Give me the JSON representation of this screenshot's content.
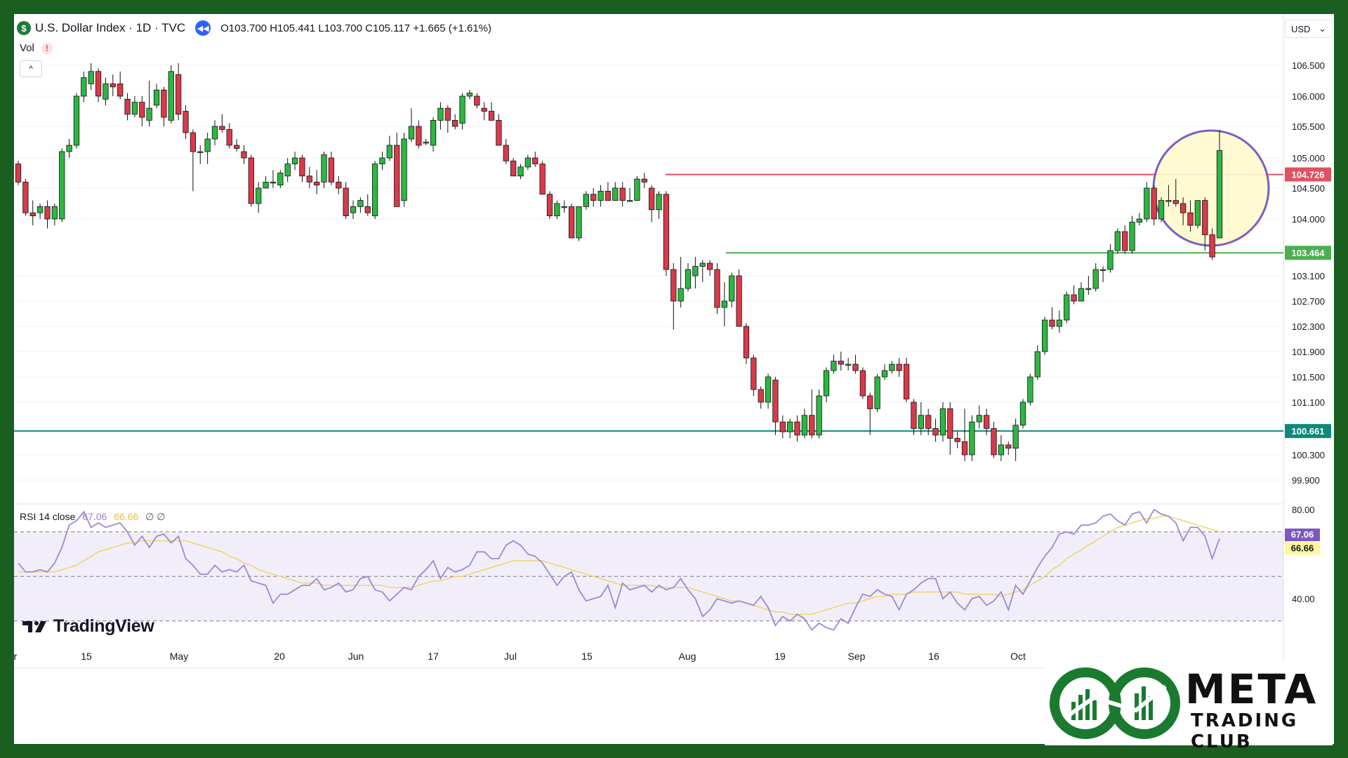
{
  "header": {
    "symbol_badge": "$",
    "title": "U.S. Dollar Index · 1D · TVC",
    "ohlc": "O103.700  H105.441  L103.700  C105.117  +1.665 (+1.61%)"
  },
  "volume_label": "Vol",
  "volume_warning": "!",
  "collapse_glyph": "^",
  "currency": {
    "label": "USD",
    "chevron": "⌄"
  },
  "rsi_legend": {
    "label": "RSI 14 close",
    "rsi": "67.06",
    "ma": "66.66",
    "extra": "∅ ∅"
  },
  "brand": {
    "tradingview": "TradingView",
    "meta": "META",
    "club": "TRADING CLUB"
  },
  "colors": {
    "frame_green": "#1a5e20",
    "up": "#2db742",
    "down": "#d93a4a",
    "resistance": "#e05262",
    "support": "#4caf50",
    "base_line": "#0f8a7a",
    "rsi_line": "#9c88d6",
    "rsi_ma": "#f0d46a",
    "highlight_circle": "#7b5fbf",
    "highlight_fill": "#fff9cc"
  },
  "chart_data": {
    "type": "candlestick",
    "price_axis_ticks": [
      "106.500",
      "106.000",
      "105.500",
      "105.000",
      "104.500",
      "104.000",
      "103.100",
      "102.700",
      "102.300",
      "101.900",
      "101.500",
      "101.100",
      "100.300",
      "99.900"
    ],
    "price_axis_values": [
      106.5,
      106.0,
      105.5,
      105.0,
      104.5,
      104.0,
      103.1,
      102.7,
      102.3,
      101.9,
      101.5,
      101.1,
      100.3,
      99.9
    ],
    "horizontal_levels": [
      {
        "label": "104.726",
        "value": 104.726,
        "role": "resistance"
      },
      {
        "label": "103.464",
        "value": 103.464,
        "role": "support"
      },
      {
        "label": "100.661",
        "value": 100.661,
        "role": "base"
      }
    ],
    "x_tick_labels": [
      "r",
      "15",
      "May",
      "20",
      "Jun",
      "17",
      "Jul",
      "15",
      "Aug",
      "19",
      "Sep",
      "16",
      "Oct"
    ],
    "rsi": {
      "axis_ticks": [
        "80.00",
        "40.00"
      ],
      "axis_values": [
        80,
        40
      ],
      "bands": [
        70,
        50,
        30
      ],
      "last_rsi": 67.06,
      "last_ma": 66.66,
      "rsi_values": [
        56,
        52,
        52,
        53,
        52,
        56,
        63,
        73,
        75,
        79,
        72,
        74,
        72,
        73,
        74,
        70,
        64,
        68,
        63,
        68,
        69,
        65,
        68,
        58,
        55,
        51,
        51,
        55,
        52,
        53,
        52,
        55,
        48,
        47,
        46,
        38,
        42,
        42,
        44,
        46,
        46,
        49,
        44,
        45,
        47,
        43,
        44,
        49,
        50,
        44,
        43,
        39,
        42,
        45,
        44,
        50,
        53,
        57,
        49,
        54,
        52,
        53,
        55,
        61,
        61,
        58,
        58,
        64,
        66,
        64,
        60,
        59,
        56,
        51,
        46,
        50,
        52,
        44,
        39,
        40,
        41,
        46,
        36,
        47,
        44,
        45,
        46,
        43,
        46,
        44,
        45,
        49,
        44,
        40,
        32,
        35,
        40,
        39,
        38,
        39,
        38,
        37,
        41,
        36,
        28,
        32,
        30,
        33,
        31,
        26,
        29,
        27,
        26,
        31,
        29,
        36,
        42,
        41,
        44,
        42,
        41,
        35,
        42,
        44,
        47,
        49,
        49,
        40,
        43,
        38,
        35,
        40,
        41,
        37,
        39,
        43,
        35,
        46,
        42,
        48,
        54,
        59,
        63,
        69,
        70,
        69,
        73,
        73,
        74,
        77,
        78,
        75,
        73,
        78,
        79,
        74,
        80,
        78,
        77,
        74,
        66,
        72,
        72,
        68,
        58,
        67
      ],
      "ma_values": [
        52,
        52,
        52,
        52,
        52,
        52,
        53,
        54,
        55,
        57,
        59,
        61,
        62,
        63,
        64,
        65,
        65,
        66,
        66,
        66,
        66,
        66,
        66,
        66,
        65,
        64,
        63,
        62,
        61,
        59,
        58,
        56,
        55,
        53,
        52,
        51,
        50,
        49,
        48,
        47,
        47,
        47,
        46,
        46,
        46,
        46,
        46,
        46,
        46,
        46,
        46,
        45,
        45,
        45,
        45,
        46,
        47,
        48,
        48,
        49,
        50,
        50,
        51,
        52,
        53,
        54,
        55,
        56,
        57,
        57,
        57,
        57,
        57,
        56,
        55,
        54,
        53,
        52,
        51,
        50,
        49,
        48,
        47,
        46,
        46,
        46,
        46,
        46,
        45,
        45,
        45,
        45,
        45,
        44,
        43,
        42,
        41,
        40,
        39,
        39,
        38,
        37,
        36,
        35,
        34,
        34,
        33,
        33,
        33,
        33,
        34,
        35,
        36,
        37,
        38,
        38,
        39,
        40,
        41,
        41,
        42,
        42,
        42,
        43,
        43,
        43,
        43,
        43,
        43,
        43,
        42,
        42,
        42,
        42,
        42,
        41,
        42,
        43,
        44,
        46,
        48,
        50,
        53,
        55,
        58,
        60,
        62,
        64,
        66,
        68,
        70,
        72,
        73,
        74,
        75,
        76,
        76,
        77,
        77,
        76,
        75,
        74,
        73,
        72,
        71,
        70
      ]
    },
    "candles": [
      [
        104.9,
        104.6,
        104.95,
        104.55
      ],
      [
        104.6,
        104.1,
        104.65,
        104.05
      ],
      [
        104.1,
        104.05,
        104.3,
        103.9
      ],
      [
        104.1,
        104.2,
        104.25,
        104.0
      ],
      [
        104.2,
        104.0,
        104.3,
        103.85
      ],
      [
        104.0,
        104.2,
        104.25,
        103.9
      ],
      [
        104.0,
        105.1,
        105.15,
        103.95
      ],
      [
        105.1,
        105.2,
        105.3,
        105.0
      ],
      [
        105.2,
        106.0,
        106.05,
        105.15
      ],
      [
        106.0,
        106.3,
        106.4,
        105.9
      ],
      [
        106.2,
        106.4,
        106.55,
        106.1
      ],
      [
        106.4,
        106.0,
        106.45,
        105.9
      ],
      [
        105.95,
        106.2,
        106.3,
        105.85
      ],
      [
        106.2,
        106.15,
        106.35,
        106.0
      ],
      [
        106.2,
        106.0,
        106.4,
        105.95
      ],
      [
        105.95,
        105.7,
        106.05,
        105.6
      ],
      [
        105.7,
        105.9,
        106.0,
        105.65
      ],
      [
        105.9,
        105.65,
        106.0,
        105.5
      ],
      [
        105.6,
        105.8,
        106.25,
        105.5
      ],
      [
        105.85,
        106.1,
        106.2,
        105.8
      ],
      [
        106.1,
        105.65,
        106.15,
        105.5
      ],
      [
        105.6,
        106.4,
        106.5,
        105.55
      ],
      [
        106.35,
        105.7,
        106.55,
        105.6
      ],
      [
        105.75,
        105.4,
        105.85,
        105.3
      ],
      [
        105.4,
        105.1,
        105.45,
        104.45
      ],
      [
        105.1,
        105.1,
        105.2,
        104.9
      ],
      [
        105.1,
        105.3,
        105.4,
        104.9
      ],
      [
        105.3,
        105.5,
        105.6,
        105.2
      ],
      [
        105.5,
        105.45,
        105.7,
        105.4
      ],
      [
        105.45,
        105.2,
        105.55,
        105.15
      ],
      [
        105.2,
        105.15,
        105.3,
        105.1
      ],
      [
        105.1,
        105.0,
        105.2,
        104.9
      ],
      [
        105.0,
        104.25,
        105.05,
        104.2
      ],
      [
        104.25,
        104.5,
        104.6,
        104.1
      ],
      [
        104.5,
        104.6,
        104.7,
        104.5
      ],
      [
        104.6,
        104.6,
        104.8,
        104.5
      ],
      [
        104.55,
        104.75,
        104.8,
        104.5
      ],
      [
        104.7,
        104.9,
        105.0,
        104.6
      ],
      [
        104.9,
        105.0,
        105.1,
        104.8
      ],
      [
        105.0,
        104.7,
        105.05,
        104.6
      ],
      [
        104.7,
        104.6,
        104.85,
        104.5
      ],
      [
        104.6,
        104.55,
        104.8,
        104.4
      ],
      [
        104.6,
        105.05,
        105.1,
        104.5
      ],
      [
        105.0,
        104.6,
        105.1,
        104.55
      ],
      [
        104.6,
        104.5,
        104.7,
        104.4
      ],
      [
        104.5,
        104.05,
        104.6,
        104.0
      ],
      [
        104.1,
        104.2,
        104.3,
        104.0
      ],
      [
        104.2,
        104.3,
        104.35,
        104.1
      ],
      [
        104.2,
        104.1,
        104.4,
        104.05
      ],
      [
        104.05,
        104.9,
        104.95,
        104.0
      ],
      [
        104.9,
        105.0,
        105.1,
        104.8
      ],
      [
        105.0,
        105.2,
        105.35,
        104.95
      ],
      [
        105.2,
        104.2,
        105.4,
        104.2
      ],
      [
        104.3,
        105.3,
        105.4,
        104.2
      ],
      [
        105.3,
        105.5,
        105.8,
        105.25
      ],
      [
        105.5,
        105.2,
        105.6,
        105.15
      ],
      [
        105.25,
        105.25,
        105.3,
        105.2
      ],
      [
        105.2,
        105.6,
        105.65,
        105.1
      ],
      [
        105.6,
        105.8,
        105.9,
        105.45
      ],
      [
        105.8,
        105.6,
        105.85,
        105.4
      ],
      [
        105.6,
        105.5,
        105.7,
        105.45
      ],
      [
        105.55,
        106.0,
        106.05,
        105.45
      ],
      [
        106.0,
        106.05,
        106.1,
        105.95
      ],
      [
        106.0,
        105.85,
        106.05,
        105.8
      ],
      [
        105.8,
        105.75,
        105.9,
        105.6
      ],
      [
        105.75,
        105.6,
        105.9,
        105.6
      ],
      [
        105.6,
        105.2,
        105.7,
        105.2
      ],
      [
        105.2,
        104.95,
        105.3,
        104.9
      ],
      [
        104.95,
        104.7,
        105.0,
        104.7
      ],
      [
        104.7,
        104.85,
        104.9,
        104.65
      ],
      [
        104.85,
        105.0,
        105.05,
        104.8
      ],
      [
        105.0,
        104.9,
        105.1,
        104.85
      ],
      [
        104.9,
        104.4,
        104.95,
        104.4
      ],
      [
        104.4,
        104.05,
        104.45,
        104.0
      ],
      [
        104.05,
        104.25,
        104.3,
        104.0
      ],
      [
        104.2,
        104.2,
        104.3,
        104.1
      ],
      [
        104.2,
        103.7,
        104.25,
        103.7
      ],
      [
        103.7,
        104.2,
        104.2,
        103.65
      ],
      [
        104.2,
        104.4,
        104.45,
        104.15
      ],
      [
        104.4,
        104.3,
        104.5,
        104.2
      ],
      [
        104.3,
        104.45,
        104.55,
        104.2
      ],
      [
        104.45,
        104.3,
        104.6,
        104.3
      ],
      [
        104.3,
        104.5,
        104.6,
        104.3
      ],
      [
        104.5,
        104.3,
        104.6,
        104.2
      ],
      [
        104.3,
        104.3,
        104.5,
        104.3
      ],
      [
        104.3,
        104.65,
        104.7,
        104.3
      ],
      [
        104.65,
        104.6,
        104.75,
        104.5
      ],
      [
        104.5,
        104.15,
        104.55,
        103.95
      ],
      [
        104.15,
        104.4,
        104.45,
        104.0
      ],
      [
        104.4,
        103.2,
        104.45,
        103.1
      ],
      [
        103.2,
        102.7,
        103.3,
        102.25
      ],
      [
        102.7,
        102.9,
        103.4,
        102.6
      ],
      [
        102.9,
        103.2,
        103.3,
        102.85
      ],
      [
        103.1,
        103.25,
        103.4,
        102.9
      ],
      [
        103.25,
        103.3,
        103.35,
        103.0
      ],
      [
        103.3,
        103.2,
        103.35,
        103.1
      ],
      [
        103.2,
        102.6,
        103.3,
        102.5
      ],
      [
        102.6,
        102.7,
        103.0,
        102.3
      ],
      [
        102.7,
        103.1,
        103.15,
        102.6
      ],
      [
        103.1,
        102.3,
        103.2,
        102.3
      ],
      [
        102.3,
        101.8,
        102.35,
        101.7
      ],
      [
        101.8,
        101.3,
        101.85,
        101.2
      ],
      [
        101.3,
        101.1,
        101.35,
        101.0
      ],
      [
        101.1,
        101.5,
        101.55,
        101.0
      ],
      [
        101.45,
        100.8,
        101.5,
        100.6
      ],
      [
        100.8,
        100.65,
        100.9,
        100.55
      ],
      [
        100.65,
        100.8,
        100.85,
        100.55
      ],
      [
        100.8,
        100.6,
        100.9,
        100.5
      ],
      [
        100.6,
        100.9,
        101.0,
        100.55
      ],
      [
        100.9,
        100.6,
        101.3,
        100.55
      ],
      [
        100.6,
        101.2,
        101.3,
        100.55
      ],
      [
        101.2,
        101.6,
        101.65,
        101.1
      ],
      [
        101.6,
        101.75,
        101.85,
        101.55
      ],
      [
        101.75,
        101.7,
        101.9,
        101.6
      ],
      [
        101.7,
        101.7,
        101.8,
        101.6
      ],
      [
        101.7,
        101.6,
        101.85,
        101.55
      ],
      [
        101.6,
        101.2,
        101.65,
        101.15
      ],
      [
        101.2,
        101.0,
        101.25,
        100.6
      ],
      [
        101.0,
        101.5,
        101.55,
        100.95
      ],
      [
        101.5,
        101.6,
        101.7,
        101.45
      ],
      [
        101.6,
        101.7,
        101.75,
        101.55
      ],
      [
        101.7,
        101.6,
        101.8,
        101.5
      ],
      [
        101.7,
        101.15,
        101.8,
        101.1
      ],
      [
        101.1,
        100.7,
        101.15,
        100.6
      ],
      [
        100.7,
        100.9,
        101.1,
        100.6
      ],
      [
        100.9,
        100.7,
        101.0,
        100.6
      ],
      [
        100.7,
        100.6,
        100.85,
        100.5
      ],
      [
        100.6,
        101.0,
        101.1,
        100.5
      ],
      [
        101.0,
        100.55,
        101.1,
        100.3
      ],
      [
        100.55,
        100.5,
        100.65,
        100.4
      ],
      [
        100.5,
        100.3,
        101.0,
        100.2
      ],
      [
        100.3,
        100.8,
        100.9,
        100.2
      ],
      [
        100.8,
        100.9,
        101.05,
        100.7
      ],
      [
        100.9,
        100.7,
        101.0,
        100.6
      ],
      [
        100.7,
        100.3,
        100.8,
        100.25
      ],
      [
        100.3,
        100.45,
        100.6,
        100.2
      ],
      [
        100.45,
        100.4,
        100.5,
        100.3
      ],
      [
        100.4,
        100.75,
        100.85,
        100.2
      ],
      [
        100.75,
        101.1,
        101.15,
        100.7
      ],
      [
        101.1,
        101.5,
        101.55,
        101.05
      ],
      [
        101.5,
        101.9,
        102.0,
        101.45
      ],
      [
        101.9,
        102.4,
        102.45,
        101.85
      ],
      [
        102.4,
        102.3,
        102.6,
        102.25
      ],
      [
        102.3,
        102.4,
        102.55,
        102.2
      ],
      [
        102.4,
        102.8,
        102.85,
        102.35
      ],
      [
        102.8,
        102.7,
        102.95,
        102.65
      ],
      [
        102.7,
        102.9,
        103.0,
        102.7
      ],
      [
        102.9,
        102.9,
        103.1,
        102.8
      ],
      [
        102.9,
        103.2,
        103.3,
        102.85
      ],
      [
        103.2,
        103.2,
        103.25,
        103.0
      ],
      [
        103.2,
        103.5,
        103.6,
        103.15
      ],
      [
        103.5,
        103.8,
        103.85,
        103.45
      ],
      [
        103.8,
        103.5,
        103.9,
        103.45
      ],
      [
        103.5,
        103.95,
        104.05,
        103.45
      ],
      [
        103.95,
        104.0,
        104.1,
        103.9
      ],
      [
        104.0,
        104.5,
        104.6,
        103.95
      ],
      [
        104.5,
        104.0,
        104.55,
        103.9
      ],
      [
        104.0,
        104.3,
        104.35,
        103.95
      ],
      [
        104.3,
        104.3,
        104.55,
        104.2
      ],
      [
        104.3,
        104.25,
        104.65,
        104.2
      ],
      [
        104.25,
        104.1,
        104.35,
        103.9
      ],
      [
        104.1,
        103.9,
        104.3,
        103.8
      ],
      [
        103.9,
        104.3,
        104.3,
        103.85
      ],
      [
        104.3,
        103.75,
        104.35,
        103.5
      ],
      [
        103.75,
        103.4,
        103.85,
        103.35
      ],
      [
        103.7,
        105.117,
        105.441,
        103.7
      ]
    ]
  }
}
